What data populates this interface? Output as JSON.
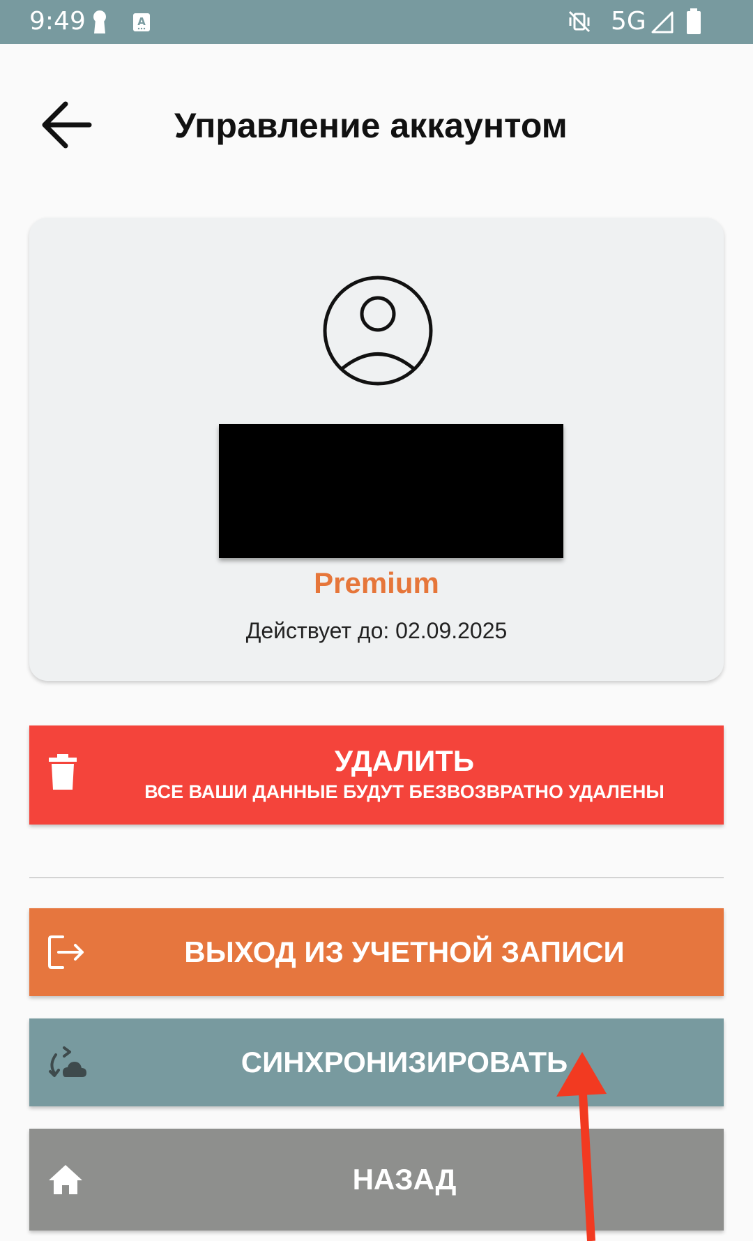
{
  "status_bar": {
    "time": "9:49",
    "network": "5G",
    "icons": [
      "keyhole-icon",
      "accessibility-a-icon",
      "vibrate-off-icon",
      "signal-icon",
      "battery-icon"
    ]
  },
  "header": {
    "title": "Управление аккаунтом",
    "back_icon": "arrow-left-icon"
  },
  "account": {
    "plan": "Premium",
    "valid_until": "Действует до: 02.09.2025",
    "avatar_icon": "user-circle-icon"
  },
  "actions": {
    "delete": {
      "label": "УДАЛИТЬ",
      "sublabel": "ВСЕ ВАШИ ДАННЫЕ БУДУТ БЕЗВОЗВРАТНО УДАЛЕНЫ",
      "icon": "trash-icon",
      "color": "#f4443b"
    },
    "logout": {
      "label": "ВЫХОД ИЗ УЧЕТНОЙ ЗАПИСИ",
      "icon": "logout-icon",
      "color": "#e6763e"
    },
    "sync": {
      "label": "СИНХРОНИЗИРОВАТЬ",
      "icon": "cloud-sync-icon",
      "color": "#789a9f"
    },
    "back": {
      "label": "НАЗАД",
      "icon": "home-icon",
      "color": "#8e8f8d"
    }
  },
  "colors": {
    "status_bar": "#789a9f",
    "premium_accent": "#e6763a",
    "annotation_arrow": "#f23a21"
  }
}
